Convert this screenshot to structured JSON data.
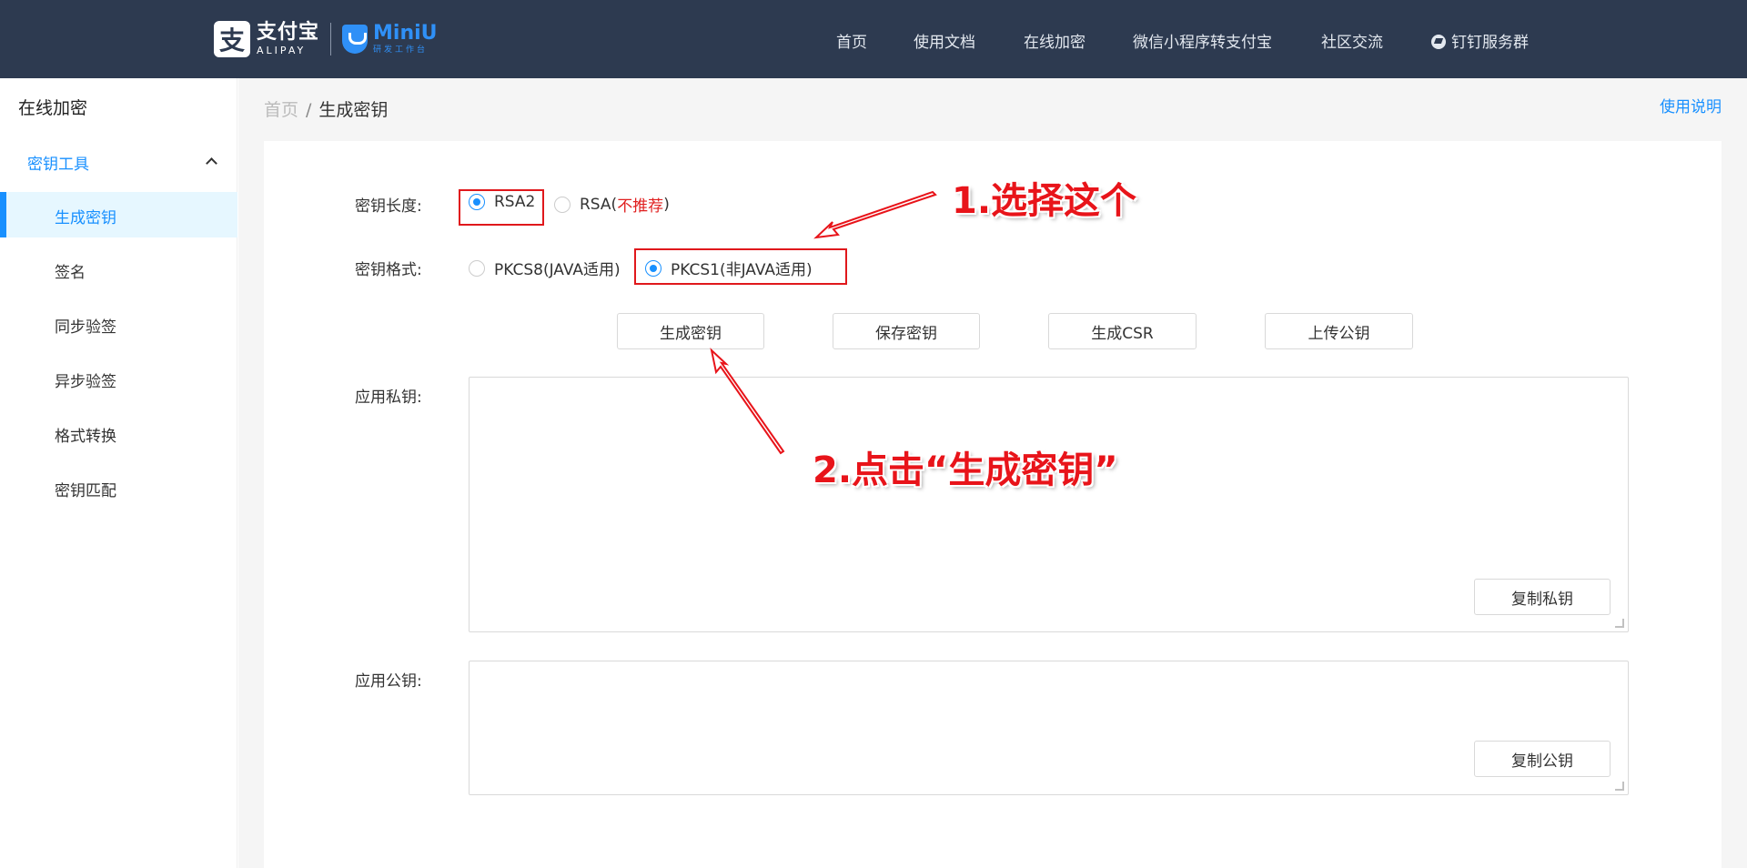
{
  "header": {
    "logo": {
      "alipay_cn": "支付宝",
      "alipay_en": "ALIPAY",
      "miniu_en": "MiniU",
      "miniu_cn": "研发工作台"
    },
    "nav": [
      {
        "label": "首页"
      },
      {
        "label": "使用文档"
      },
      {
        "label": "在线加密"
      },
      {
        "label": "微信小程序转支付宝"
      },
      {
        "label": "社区交流"
      },
      {
        "label": "钉钉服务群",
        "icon": "dingtalk-icon"
      }
    ]
  },
  "sidebar": {
    "title": "在线加密",
    "group": {
      "label": "密钥工具",
      "icon": "chevron-up-icon"
    },
    "items": [
      {
        "label": "生成密钥",
        "active": true
      },
      {
        "label": "签名"
      },
      {
        "label": "同步验签"
      },
      {
        "label": "异步验签"
      },
      {
        "label": "格式转换"
      },
      {
        "label": "密钥匹配"
      }
    ]
  },
  "breadcrumb": {
    "home": "首页",
    "separator": "/",
    "current": "生成密钥"
  },
  "help_link": "使用说明",
  "form": {
    "key_length": {
      "label": "密钥长度:",
      "options": [
        {
          "label": "RSA2",
          "checked": true
        },
        {
          "label": "RSA(",
          "note": "不推荐",
          "suffix": ")",
          "checked": false
        }
      ]
    },
    "key_format": {
      "label": "密钥格式:",
      "options": [
        {
          "label": "PKCS8(JAVA适用)",
          "checked": false
        },
        {
          "label": "PKCS1(非JAVA适用)",
          "checked": true
        }
      ]
    },
    "buttons": {
      "generate": "生成密钥",
      "save": "保存密钥",
      "csr": "生成CSR",
      "upload": "上传公钥"
    },
    "private_key": {
      "label": "应用私钥:",
      "value": "",
      "copy_button": "复制私钥"
    },
    "public_key": {
      "label": "应用公钥:",
      "value": "",
      "copy_button": "复制公钥"
    }
  },
  "annotations": {
    "step1": "1.选择这个",
    "step2": "2.点击“生成密钥”",
    "color": "#e8141a"
  },
  "colors": {
    "topbar": "#2d3a50",
    "accent": "#1890ff",
    "warning": "#e02020"
  }
}
